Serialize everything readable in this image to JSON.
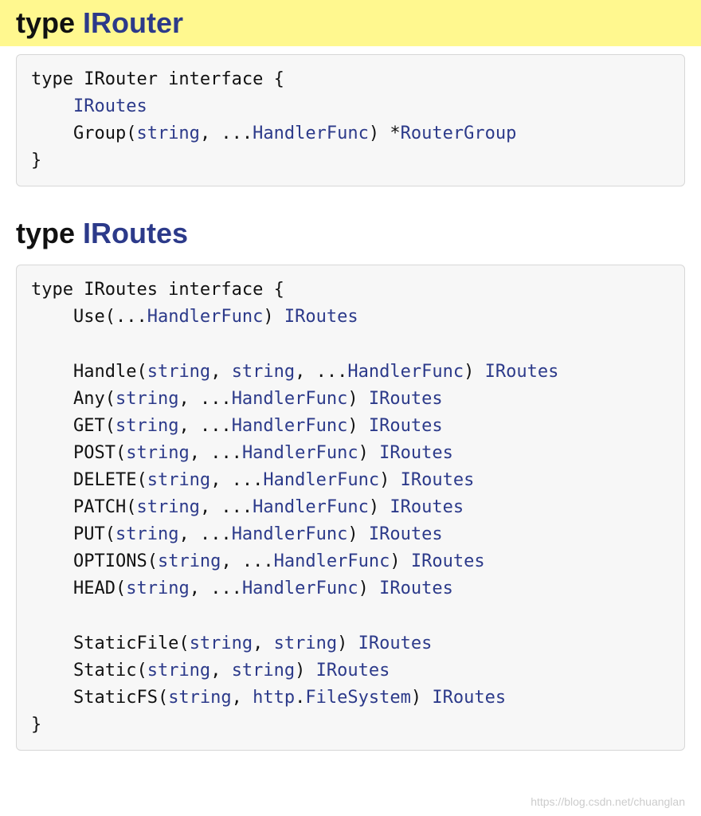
{
  "sections": [
    {
      "heading_kw": "type",
      "heading_name": "IRouter",
      "highlight": true,
      "code": [
        {
          "t": "plain",
          "s": "type IRouter interface {"
        },
        {
          "br": true
        },
        {
          "t": "plain",
          "s": "    "
        },
        {
          "t": "link",
          "s": "IRoutes"
        },
        {
          "br": true
        },
        {
          "t": "plain",
          "s": "    Group("
        },
        {
          "t": "builtin",
          "s": "string"
        },
        {
          "t": "plain",
          "s": ", ..."
        },
        {
          "t": "link",
          "s": "HandlerFunc"
        },
        {
          "t": "plain",
          "s": ") *"
        },
        {
          "t": "link",
          "s": "RouterGroup"
        },
        {
          "br": true
        },
        {
          "t": "plain",
          "s": "}"
        }
      ]
    },
    {
      "heading_kw": "type",
      "heading_name": "IRoutes",
      "highlight": false,
      "code": [
        {
          "t": "plain",
          "s": "type IRoutes interface {"
        },
        {
          "br": true
        },
        {
          "t": "plain",
          "s": "    Use(..."
        },
        {
          "t": "link",
          "s": "HandlerFunc"
        },
        {
          "t": "plain",
          "s": ") "
        },
        {
          "t": "link",
          "s": "IRoutes"
        },
        {
          "br": true
        },
        {
          "br": true
        },
        {
          "t": "plain",
          "s": "    Handle("
        },
        {
          "t": "builtin",
          "s": "string"
        },
        {
          "t": "plain",
          "s": ", "
        },
        {
          "t": "builtin",
          "s": "string"
        },
        {
          "t": "plain",
          "s": ", ..."
        },
        {
          "t": "link",
          "s": "HandlerFunc"
        },
        {
          "t": "plain",
          "s": ") "
        },
        {
          "t": "link",
          "s": "IRoutes"
        },
        {
          "br": true
        },
        {
          "t": "plain",
          "s": "    Any("
        },
        {
          "t": "builtin",
          "s": "string"
        },
        {
          "t": "plain",
          "s": ", ..."
        },
        {
          "t": "link",
          "s": "HandlerFunc"
        },
        {
          "t": "plain",
          "s": ") "
        },
        {
          "t": "link",
          "s": "IRoutes"
        },
        {
          "br": true
        },
        {
          "t": "plain",
          "s": "    GET("
        },
        {
          "t": "builtin",
          "s": "string"
        },
        {
          "t": "plain",
          "s": ", ..."
        },
        {
          "t": "link",
          "s": "HandlerFunc"
        },
        {
          "t": "plain",
          "s": ") "
        },
        {
          "t": "link",
          "s": "IRoutes"
        },
        {
          "br": true
        },
        {
          "t": "plain",
          "s": "    POST("
        },
        {
          "t": "builtin",
          "s": "string"
        },
        {
          "t": "plain",
          "s": ", ..."
        },
        {
          "t": "link",
          "s": "HandlerFunc"
        },
        {
          "t": "plain",
          "s": ") "
        },
        {
          "t": "link",
          "s": "IRoutes"
        },
        {
          "br": true
        },
        {
          "t": "plain",
          "s": "    DELETE("
        },
        {
          "t": "builtin",
          "s": "string"
        },
        {
          "t": "plain",
          "s": ", ..."
        },
        {
          "t": "link",
          "s": "HandlerFunc"
        },
        {
          "t": "plain",
          "s": ") "
        },
        {
          "t": "link",
          "s": "IRoutes"
        },
        {
          "br": true
        },
        {
          "t": "plain",
          "s": "    PATCH("
        },
        {
          "t": "builtin",
          "s": "string"
        },
        {
          "t": "plain",
          "s": ", ..."
        },
        {
          "t": "link",
          "s": "HandlerFunc"
        },
        {
          "t": "plain",
          "s": ") "
        },
        {
          "t": "link",
          "s": "IRoutes"
        },
        {
          "br": true
        },
        {
          "t": "plain",
          "s": "    PUT("
        },
        {
          "t": "builtin",
          "s": "string"
        },
        {
          "t": "plain",
          "s": ", ..."
        },
        {
          "t": "link",
          "s": "HandlerFunc"
        },
        {
          "t": "plain",
          "s": ") "
        },
        {
          "t": "link",
          "s": "IRoutes"
        },
        {
          "br": true
        },
        {
          "t": "plain",
          "s": "    OPTIONS("
        },
        {
          "t": "builtin",
          "s": "string"
        },
        {
          "t": "plain",
          "s": ", ..."
        },
        {
          "t": "link",
          "s": "HandlerFunc"
        },
        {
          "t": "plain",
          "s": ") "
        },
        {
          "t": "link",
          "s": "IRoutes"
        },
        {
          "br": true
        },
        {
          "t": "plain",
          "s": "    HEAD("
        },
        {
          "t": "builtin",
          "s": "string"
        },
        {
          "t": "plain",
          "s": ", ..."
        },
        {
          "t": "link",
          "s": "HandlerFunc"
        },
        {
          "t": "plain",
          "s": ") "
        },
        {
          "t": "link",
          "s": "IRoutes"
        },
        {
          "br": true
        },
        {
          "br": true
        },
        {
          "t": "plain",
          "s": "    StaticFile("
        },
        {
          "t": "builtin",
          "s": "string"
        },
        {
          "t": "plain",
          "s": ", "
        },
        {
          "t": "builtin",
          "s": "string"
        },
        {
          "t": "plain",
          "s": ") "
        },
        {
          "t": "link",
          "s": "IRoutes"
        },
        {
          "br": true
        },
        {
          "t": "plain",
          "s": "    Static("
        },
        {
          "t": "builtin",
          "s": "string"
        },
        {
          "t": "plain",
          "s": ", "
        },
        {
          "t": "builtin",
          "s": "string"
        },
        {
          "t": "plain",
          "s": ") "
        },
        {
          "t": "link",
          "s": "IRoutes"
        },
        {
          "br": true
        },
        {
          "t": "plain",
          "s": "    StaticFS("
        },
        {
          "t": "builtin",
          "s": "string"
        },
        {
          "t": "plain",
          "s": ", "
        },
        {
          "t": "link",
          "s": "http"
        },
        {
          "t": "plain",
          "s": "."
        },
        {
          "t": "link",
          "s": "FileSystem"
        },
        {
          "t": "plain",
          "s": ") "
        },
        {
          "t": "link",
          "s": "IRoutes"
        },
        {
          "br": true
        },
        {
          "t": "plain",
          "s": "}"
        }
      ]
    }
  ],
  "watermark": "https://blog.csdn.net/chuanglan"
}
